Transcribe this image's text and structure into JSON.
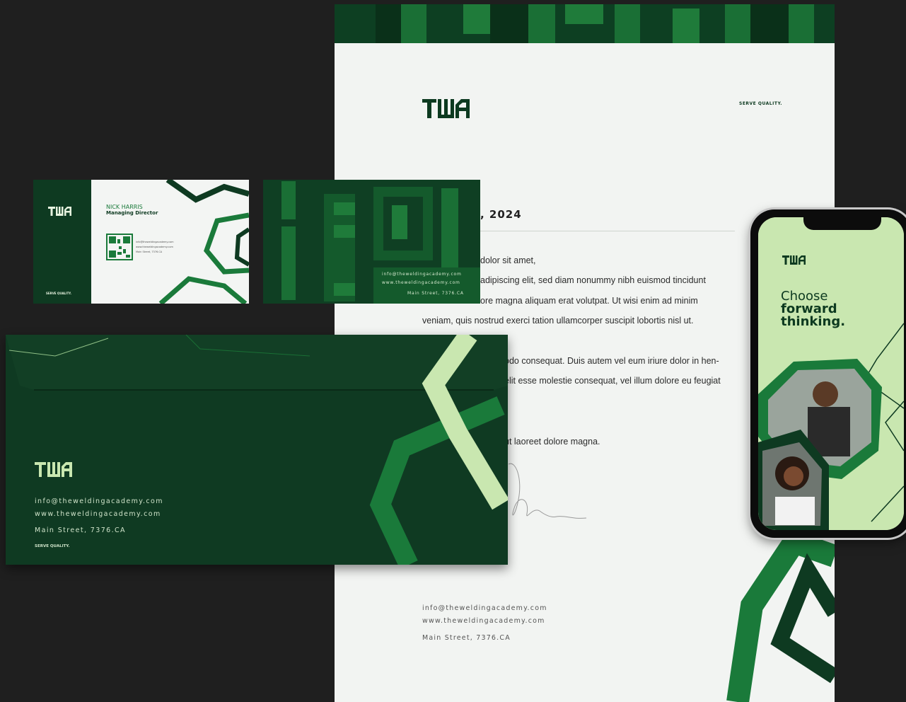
{
  "brand": {
    "tagline": "SERVE QUALITY."
  },
  "letterhead": {
    "date": ", 2024",
    "body_lines": [
      "dolor sit amet,",
      "adipiscing elit, sed diam nonummy nibh euismod tincidunt",
      "ore magna aliquam erat volutpat. Ut wisi enim ad minim",
      "veniam, quis nostrud exerci tation ullamcorper suscipit lobortis nisl ut.",
      "odo consequat. Duis autem vel eum iriure dolor in hen-",
      "elit esse molestie consequat, vel illum dolore eu feugiat",
      "ut laoreet dolore magna."
    ],
    "email": "info@theweldingacademy.com",
    "website": "www.theweldingacademy.com",
    "address": "Main Street, 7376.CA"
  },
  "business_card": {
    "name": "NICK HARRIS",
    "title": "Managing Director",
    "email": "info@theweldingacademy.com",
    "website": "www.theweldingacademy.com",
    "address": "Main Street, 7376.CA"
  },
  "envelope": {
    "email": "info@theweldingacademy.com",
    "website": "www.theweldingacademy.com",
    "address": "Main Street, 7376.CA"
  },
  "phone": {
    "headline_1": "Choose",
    "headline_2": "forward",
    "headline_3": "thinking."
  },
  "colors": {
    "dark_green": "#0e3a21",
    "mid_green": "#1a7a3a",
    "light_green": "#c9e7b0",
    "background": "#1f1f1f"
  }
}
